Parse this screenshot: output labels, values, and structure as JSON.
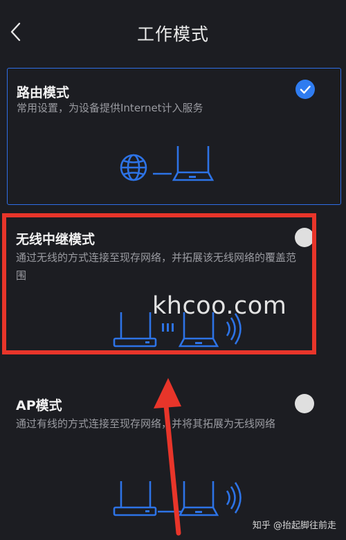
{
  "header": {
    "title": "工作模式",
    "back_icon": "chevron-left-icon"
  },
  "modes": [
    {
      "name": "路由模式",
      "description": "常用设置，为设备提供Internet计入服务",
      "selected": true
    },
    {
      "name": "无线中继模式",
      "description": "通过无线的方式连接至现存网络，并拓展该无线网络的覆盖范围",
      "selected": false
    },
    {
      "name": "AP模式",
      "description": "通过有线的方式连接至现存网络，并将其拓展为无线网络",
      "selected": false
    }
  ],
  "colors": {
    "accent": "#2f7cf0",
    "illustration": "#2d73e6",
    "annotation": "#e8352a",
    "background": "#1c1d22"
  },
  "watermark": "khcoo.com",
  "credit": "知乎 @抬起脚往前走"
}
